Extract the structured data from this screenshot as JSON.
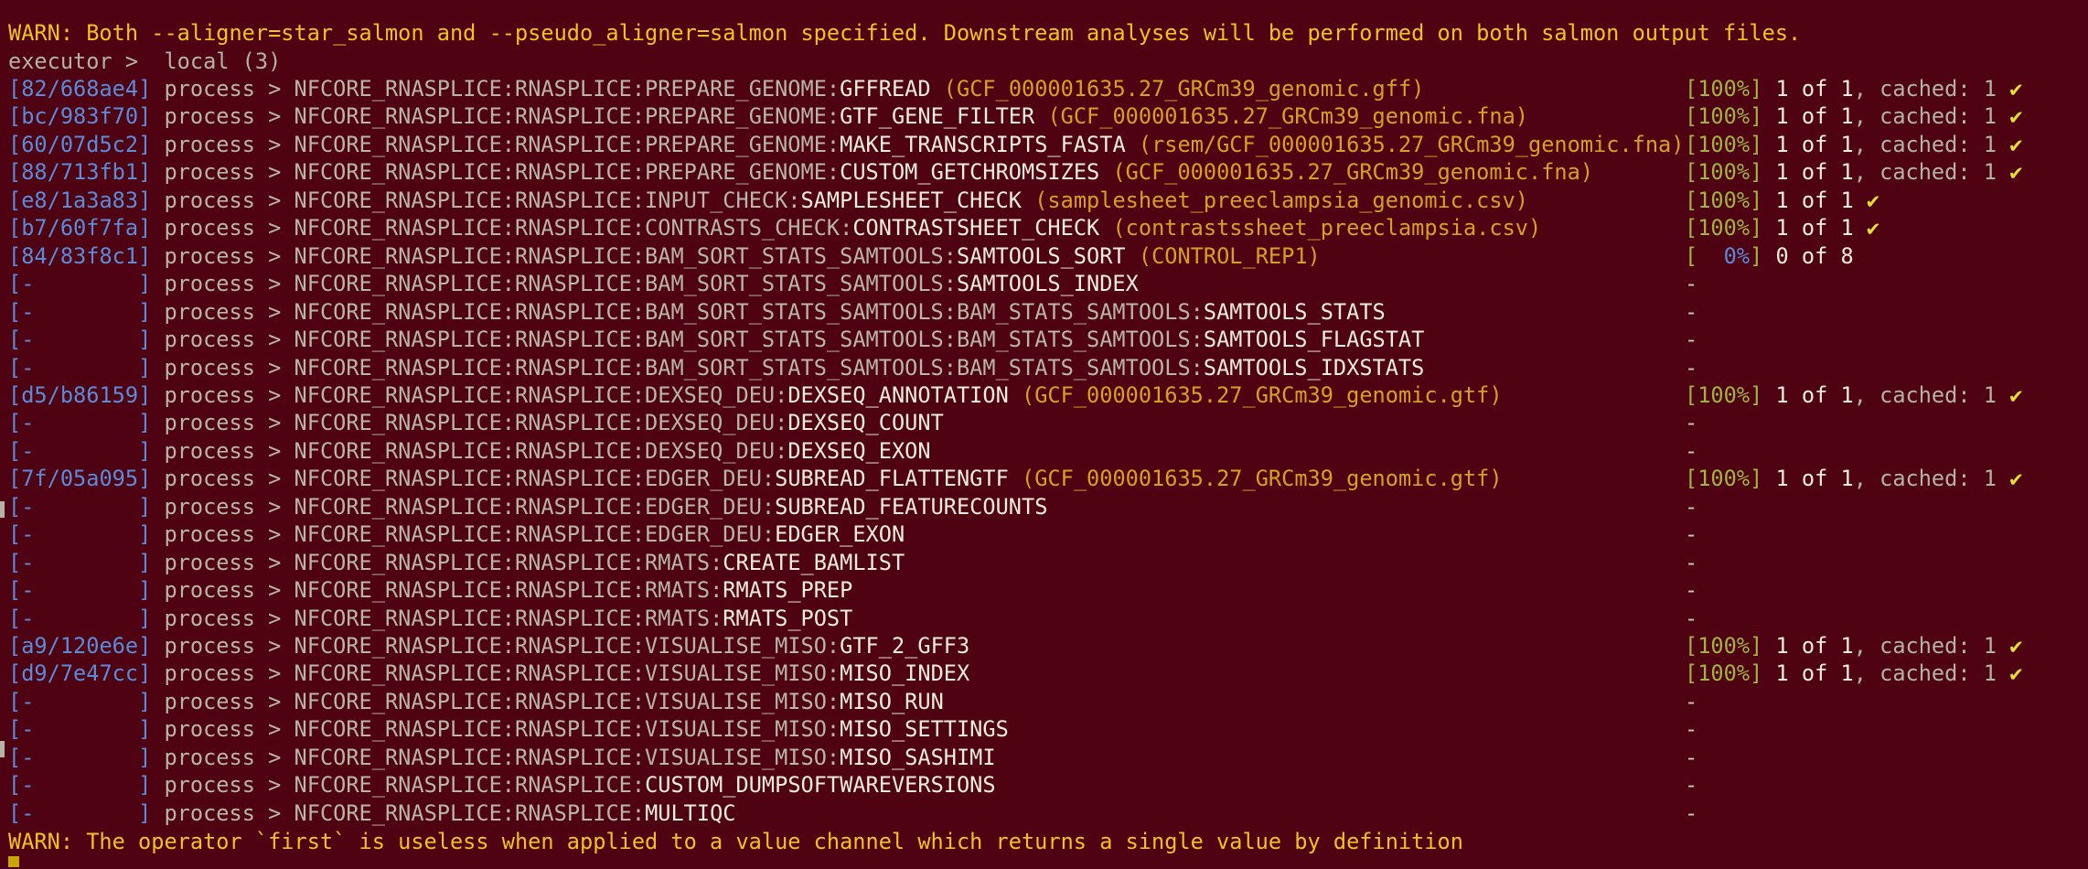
{
  "warnings": {
    "top": "WARN: Both --aligner=star_salmon and --pseudo_aligner=salmon specified. Downstream analyses will be performed on both salmon output files.",
    "bottom": "WARN: The operator `first` is useless when applied to a value channel which returns a single value by definition"
  },
  "executor": "executor >  local (3)",
  "arrow": "process > ",
  "processes": [
    {
      "hash": "82/668ae4",
      "path": "NFCORE_RNASPLICE:RNASPLICE:PREPARE_GENOME:",
      "name": "GFFREAD",
      "tag": "(GCF_000001635.27_GRCm39_genomic.gff)",
      "pct": "100%",
      "counts": "1 of 1",
      "cached": ", cached: 1",
      "done": true
    },
    {
      "hash": "bc/983f70",
      "path": "NFCORE_RNASPLICE:RNASPLICE:PREPARE_GENOME:",
      "name": "GTF_GENE_FILTER",
      "tag": "(GCF_000001635.27_GRCm39_genomic.fna)",
      "pct": "100%",
      "counts": "1 of 1",
      "cached": ", cached: 1",
      "done": true
    },
    {
      "hash": "60/07d5c2",
      "path": "NFCORE_RNASPLICE:RNASPLICE:PREPARE_GENOME:",
      "name": "MAKE_TRANSCRIPTS_FASTA",
      "tag": "(rsem/GCF_000001635.27_GRCm39_genomic.fna)",
      "pct": "100%",
      "counts": "1 of 1",
      "cached": ", cached: 1",
      "done": true
    },
    {
      "hash": "88/713fb1",
      "path": "NFCORE_RNASPLICE:RNASPLICE:PREPARE_GENOME:",
      "name": "CUSTOM_GETCHROMSIZES",
      "tag": "(GCF_000001635.27_GRCm39_genomic.fna)",
      "pct": "100%",
      "counts": "1 of 1",
      "cached": ", cached: 1",
      "done": true
    },
    {
      "hash": "e8/1a3a83",
      "path": "NFCORE_RNASPLICE:RNASPLICE:INPUT_CHECK:",
      "name": "SAMPLESHEET_CHECK",
      "tag": "(samplesheet_preeclampsia_genomic.csv)",
      "pct": "100%",
      "counts": "1 of 1",
      "cached": "",
      "done": true
    },
    {
      "hash": "b7/60f7fa",
      "path": "NFCORE_RNASPLICE:RNASPLICE:CONTRASTS_CHECK:",
      "name": "CONTRASTSHEET_CHECK",
      "tag": "(contrastssheet_preeclampsia.csv)",
      "pct": "100%",
      "counts": "1 of 1",
      "cached": "",
      "done": true
    },
    {
      "hash": "84/83f8c1",
      "path": "NFCORE_RNASPLICE:RNASPLICE:BAM_SORT_STATS_SAMTOOLS:",
      "name": "SAMTOOLS_SORT",
      "tag": "(CONTROL_REP1)",
      "pct": "  0%",
      "counts": "0 of 8",
      "cached": "",
      "done": false
    },
    {
      "hash": "-        ",
      "path": "NFCORE_RNASPLICE:RNASPLICE:BAM_SORT_STATS_SAMTOOLS:",
      "name": "SAMTOOLS_INDEX",
      "tag": "",
      "pct": "",
      "counts": "",
      "cached": "",
      "done": false
    },
    {
      "hash": "-        ",
      "path": "NFCORE_RNASPLICE:RNASPLICE:BAM_SORT_STATS_SAMTOOLS:BAM_STATS_SAMTOOLS:",
      "name": "SAMTOOLS_STATS",
      "tag": "",
      "pct": "",
      "counts": "",
      "cached": "",
      "done": false
    },
    {
      "hash": "-        ",
      "path": "NFCORE_RNASPLICE:RNASPLICE:BAM_SORT_STATS_SAMTOOLS:BAM_STATS_SAMTOOLS:",
      "name": "SAMTOOLS_FLAGSTAT",
      "tag": "",
      "pct": "",
      "counts": "",
      "cached": "",
      "done": false
    },
    {
      "hash": "-        ",
      "path": "NFCORE_RNASPLICE:RNASPLICE:BAM_SORT_STATS_SAMTOOLS:BAM_STATS_SAMTOOLS:",
      "name": "SAMTOOLS_IDXSTATS",
      "tag": "",
      "pct": "",
      "counts": "",
      "cached": "",
      "done": false
    },
    {
      "hash": "d5/b86159",
      "path": "NFCORE_RNASPLICE:RNASPLICE:DEXSEQ_DEU:",
      "name": "DEXSEQ_ANNOTATION",
      "tag": "(GCF_000001635.27_GRCm39_genomic.gtf)",
      "pct": "100%",
      "counts": "1 of 1",
      "cached": ", cached: 1",
      "done": true
    },
    {
      "hash": "-        ",
      "path": "NFCORE_RNASPLICE:RNASPLICE:DEXSEQ_DEU:",
      "name": "DEXSEQ_COUNT",
      "tag": "",
      "pct": "",
      "counts": "",
      "cached": "",
      "done": false
    },
    {
      "hash": "-        ",
      "path": "NFCORE_RNASPLICE:RNASPLICE:DEXSEQ_DEU:",
      "name": "DEXSEQ_EXON",
      "tag": "",
      "pct": "",
      "counts": "",
      "cached": "",
      "done": false
    },
    {
      "hash": "7f/05a095",
      "path": "NFCORE_RNASPLICE:RNASPLICE:EDGER_DEU:",
      "name": "SUBREAD_FLATTENGTF",
      "tag": "(GCF_000001635.27_GRCm39_genomic.gtf)",
      "pct": "100%",
      "counts": "1 of 1",
      "cached": ", cached: 1",
      "done": true
    },
    {
      "hash": "-        ",
      "path": "NFCORE_RNASPLICE:RNASPLICE:EDGER_DEU:",
      "name": "SUBREAD_FEATURECOUNTS",
      "tag": "",
      "pct": "",
      "counts": "",
      "cached": "",
      "done": false
    },
    {
      "hash": "-        ",
      "path": "NFCORE_RNASPLICE:RNASPLICE:EDGER_DEU:",
      "name": "EDGER_EXON",
      "tag": "",
      "pct": "",
      "counts": "",
      "cached": "",
      "done": false
    },
    {
      "hash": "-        ",
      "path": "NFCORE_RNASPLICE:RNASPLICE:RMATS:",
      "name": "CREATE_BAMLIST",
      "tag": "",
      "pct": "",
      "counts": "",
      "cached": "",
      "done": false
    },
    {
      "hash": "-        ",
      "path": "NFCORE_RNASPLICE:RNASPLICE:RMATS:",
      "name": "RMATS_PREP",
      "tag": "",
      "pct": "",
      "counts": "",
      "cached": "",
      "done": false
    },
    {
      "hash": "-        ",
      "path": "NFCORE_RNASPLICE:RNASPLICE:RMATS:",
      "name": "RMATS_POST",
      "tag": "",
      "pct": "",
      "counts": "",
      "cached": "",
      "done": false
    },
    {
      "hash": "a9/120e6e",
      "path": "NFCORE_RNASPLICE:RNASPLICE:VISUALISE_MISO:",
      "name": "GTF_2_GFF3",
      "tag": "",
      "pct": "100%",
      "counts": "1 of 1",
      "cached": ", cached: 1",
      "done": true
    },
    {
      "hash": "d9/7e47cc",
      "path": "NFCORE_RNASPLICE:RNASPLICE:VISUALISE_MISO:",
      "name": "MISO_INDEX",
      "tag": "",
      "pct": "100%",
      "counts": "1 of 1",
      "cached": ", cached: 1",
      "done": true
    },
    {
      "hash": "-        ",
      "path": "NFCORE_RNASPLICE:RNASPLICE:VISUALISE_MISO:",
      "name": "MISO_RUN",
      "tag": "",
      "pct": "",
      "counts": "",
      "cached": "",
      "done": false
    },
    {
      "hash": "-        ",
      "path": "NFCORE_RNASPLICE:RNASPLICE:VISUALISE_MISO:",
      "name": "MISO_SETTINGS",
      "tag": "",
      "pct": "",
      "counts": "",
      "cached": "",
      "done": false
    },
    {
      "hash": "-        ",
      "path": "NFCORE_RNASPLICE:RNASPLICE:VISUALISE_MISO:",
      "name": "MISO_SASHIMI",
      "tag": "",
      "pct": "",
      "counts": "",
      "cached": "",
      "done": false
    },
    {
      "hash": "-        ",
      "path": "NFCORE_RNASPLICE:RNASPLICE:",
      "name": "CUSTOM_DUMPSOFTWAREVERSIONS",
      "tag": "",
      "pct": "",
      "counts": "",
      "cached": "",
      "done": false
    },
    {
      "hash": "-        ",
      "path": "NFCORE_RNASPLICE:RNASPLICE:",
      "name": "MULTIQC",
      "tag": "",
      "pct": "",
      "counts": "",
      "cached": "",
      "done": false
    }
  ],
  "symbols": {
    "check": "✔",
    "pending": "-"
  },
  "colors": {
    "background": "#4e0212",
    "warn": "#f2c31a",
    "hash": "#5a8cd9",
    "percent": "#a1b43e",
    "check": "#e4e02e",
    "process_name": "#f0eddc"
  }
}
